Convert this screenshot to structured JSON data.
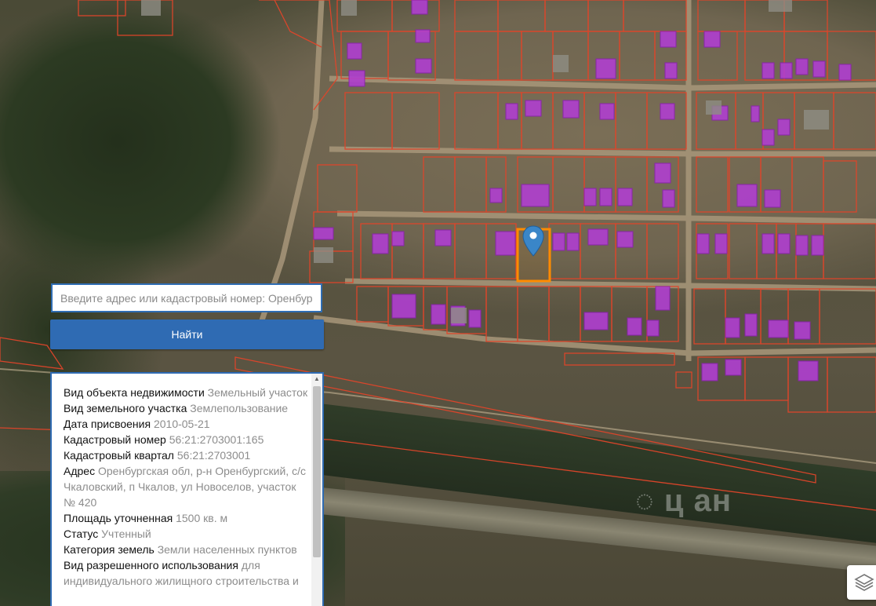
{
  "search": {
    "placeholder": "Введите адрес или кадастровый номер: Оренбургская обл, р-н Оренбургский"
  },
  "find_button": {
    "label": "Найти"
  },
  "property_info": [
    {
      "label": "Вид объекта недвижимости",
      "value": "Земельный участок"
    },
    {
      "label": "Вид земельного участка",
      "value": "Землепользование"
    },
    {
      "label": "Дата присвоения",
      "value": "2010-05-21"
    },
    {
      "label": "Кадастровый номер",
      "value": "56:21:2703001:165"
    },
    {
      "label": "Кадастровый квартал",
      "value": "56:21:2703001"
    },
    {
      "label": "Адрес",
      "value": "Оренбургская обл, р-н Оренбургский, с/с Чкаловский, п Чкалов, ул Новоселов, участок № 420"
    },
    {
      "label": "Площадь уточненная",
      "value": "1500 кв. м"
    },
    {
      "label": "Статус",
      "value": "Учтенный"
    },
    {
      "label": "Категория земель",
      "value": "Земли населенных пунктов"
    },
    {
      "label": "Вид разрешенного использования",
      "value": "для индивидуального жилищного строительства и"
    }
  ],
  "icons": {
    "map_marker": "map-marker-icon",
    "layers": "layers-icon"
  },
  "colors": {
    "accent": "#2f6bb3",
    "parcel_border": "#e0452a",
    "building_fill": "#b03fd0",
    "selected_parcel": "#ff8c00",
    "marker": "#3a86c8"
  }
}
